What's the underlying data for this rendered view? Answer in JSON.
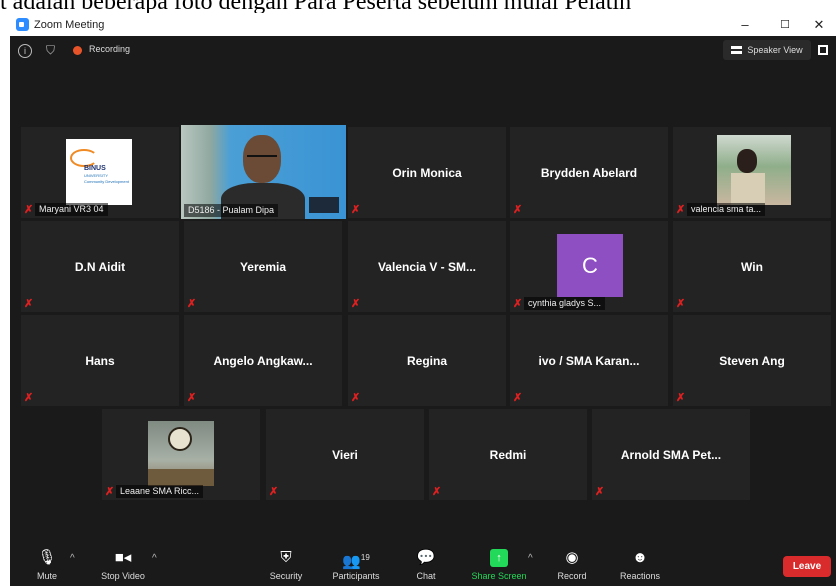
{
  "caption_text": "t adalah beberapa foto dengan Para Peserta sebelum mulai Pelatih",
  "window": {
    "title": "Zoom Meeting",
    "controls": [
      "–",
      "☐",
      "✕"
    ]
  },
  "topbar": {
    "recording_label": "Recording",
    "speaker_view_label": "Speaker View"
  },
  "thumbnails": {
    "binus_logo_text": "BINUS",
    "binus_sub": "UNIVERSITY",
    "binus_caption": "Community Development"
  },
  "participants": [
    {
      "id": "maryani",
      "name": "Maryani VR3 04",
      "kind": "logo"
    },
    {
      "id": "pualam",
      "name": "D5186 - Pualam Dipa",
      "kind": "video"
    },
    {
      "id": "orin",
      "name": "Orin Monica",
      "kind": "name"
    },
    {
      "id": "brydden",
      "name": "Brydden Abelard",
      "kind": "name"
    },
    {
      "id": "valencia-sma",
      "name": "valencia sma ta...",
      "kind": "photo"
    },
    {
      "id": "dn-aidit",
      "name": "D.N Aidit",
      "kind": "name"
    },
    {
      "id": "yeremia",
      "name": "Yeremia",
      "kind": "name"
    },
    {
      "id": "valencia-v",
      "name": "Valencia V - SM...",
      "kind": "name"
    },
    {
      "id": "cynthia",
      "name": "cynthia gladys S...",
      "kind": "avatar",
      "avatar_letter": "C",
      "avatar_color": "#8e4fc2"
    },
    {
      "id": "win",
      "name": "Win",
      "kind": "name"
    },
    {
      "id": "hans",
      "name": "Hans",
      "kind": "name"
    },
    {
      "id": "angelo",
      "name": "Angelo  Angkaw...",
      "kind": "name"
    },
    {
      "id": "regina",
      "name": "Regina",
      "kind": "name"
    },
    {
      "id": "ivo",
      "name": "ivo / SMA Karan...",
      "kind": "name"
    },
    {
      "id": "steven",
      "name": "Steven Ang",
      "kind": "name"
    },
    {
      "id": "leaane",
      "name": "Leaane SMA Ricc...",
      "kind": "photo"
    },
    {
      "id": "vieri",
      "name": "Vieri",
      "kind": "name"
    },
    {
      "id": "redmi",
      "name": "Redmi",
      "kind": "name"
    },
    {
      "id": "arnold",
      "name": "Arnold SMA Pet...",
      "kind": "name"
    }
  ],
  "toolbar": {
    "mute_label": "Mute",
    "stop_video_label": "Stop Video",
    "security_label": "Security",
    "participants_label": "Participants",
    "participants_count": "19",
    "chat_label": "Chat",
    "share_screen_label": "Share Screen",
    "record_label": "Record",
    "reactions_label": "Reactions",
    "leave_label": "Leave"
  },
  "colors": {
    "accent_green": "#23d959",
    "leave_red": "#d92b2b",
    "active_speaker": "#d8e24b",
    "recording": "#e8542a"
  }
}
